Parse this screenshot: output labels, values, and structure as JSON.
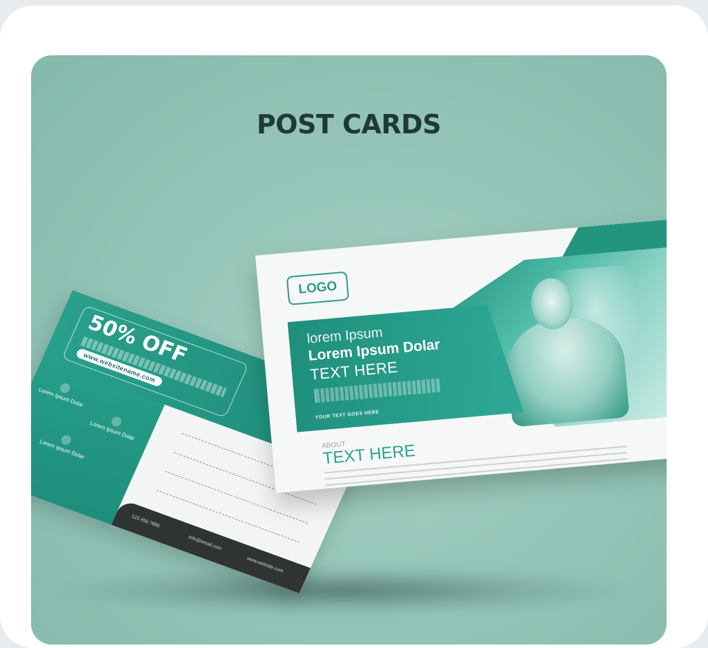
{
  "hero": {
    "title": "POST CARDS"
  },
  "back_card": {
    "offer": "50% OFF",
    "website": "www.websitename.com",
    "features": [
      "Lorem Ipsum Dolar",
      "Lorem Ipsum Dolar",
      "Lorem Ipsum Dolar"
    ],
    "footer": {
      "phone": "123 456 7890",
      "email": "info@email.com",
      "web": "www.website.com"
    }
  },
  "front_card": {
    "logo": "LOGO",
    "line1": "lorem Ipsum",
    "line2": "Lorem Ipsum Dolar",
    "line3": "TEXT HERE",
    "cta": "YOUR TEXT GOES HERE",
    "about_label": "ABOUT",
    "about_title": "TEXT HERE"
  },
  "colors": {
    "accent": "#2aa38f",
    "background": "#96c6b9",
    "title": "#1f3a36"
  }
}
